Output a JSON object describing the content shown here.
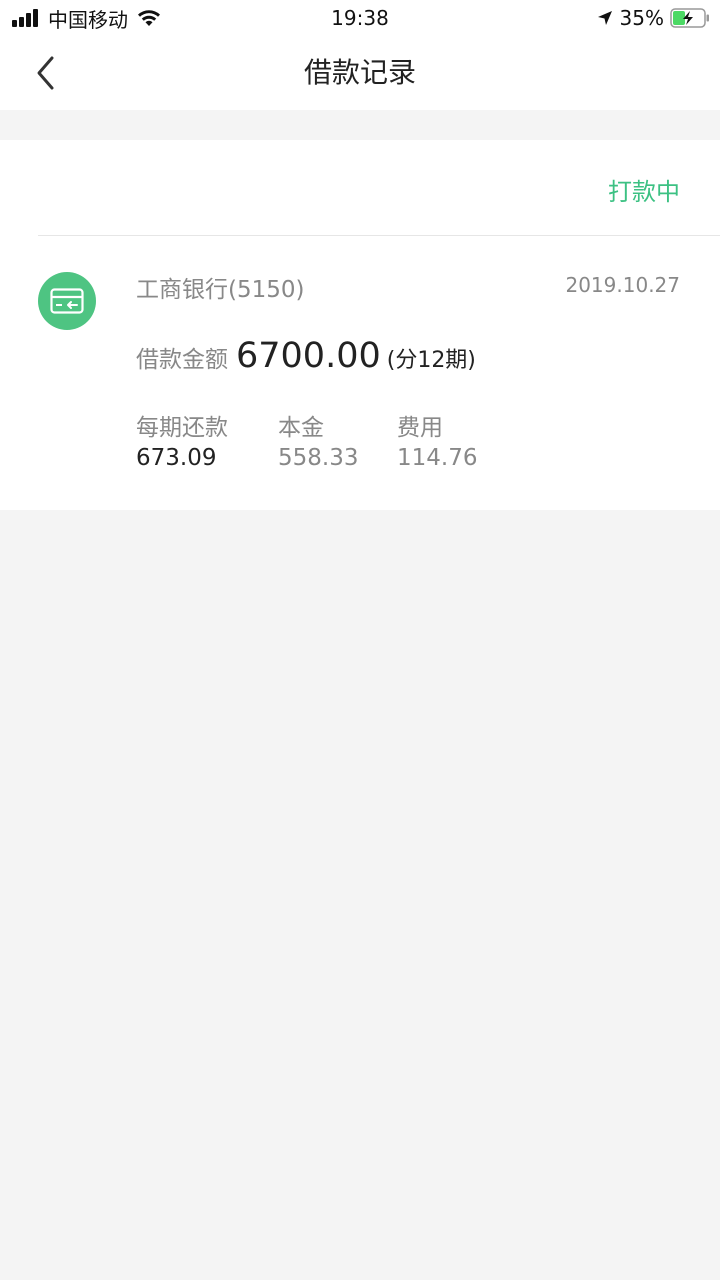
{
  "status_bar": {
    "carrier": "中国移动",
    "time": "19:38",
    "battery_percent": "35%",
    "icons": [
      "signal-icon",
      "wifi-icon",
      "location-arrow-icon",
      "battery-charging-icon"
    ]
  },
  "nav": {
    "title": "借款记录",
    "back_icon": "chevron-left-icon"
  },
  "record": {
    "status": "打款中",
    "bank": "工商银行(5150)",
    "date": "2019.10.27",
    "amount_label": "借款金额",
    "amount": "6700.00",
    "term": "(分12期)",
    "breakdown": [
      {
        "label": "每期还款",
        "value": "673.09"
      },
      {
        "label": "本金",
        "value": "558.33"
      },
      {
        "label": "费用",
        "value": "114.76"
      }
    ],
    "icon": "bank-card-icon"
  },
  "colors": {
    "accent_green": "#3cc183",
    "icon_green": "#4ec482",
    "background": "#f4f4f4"
  }
}
